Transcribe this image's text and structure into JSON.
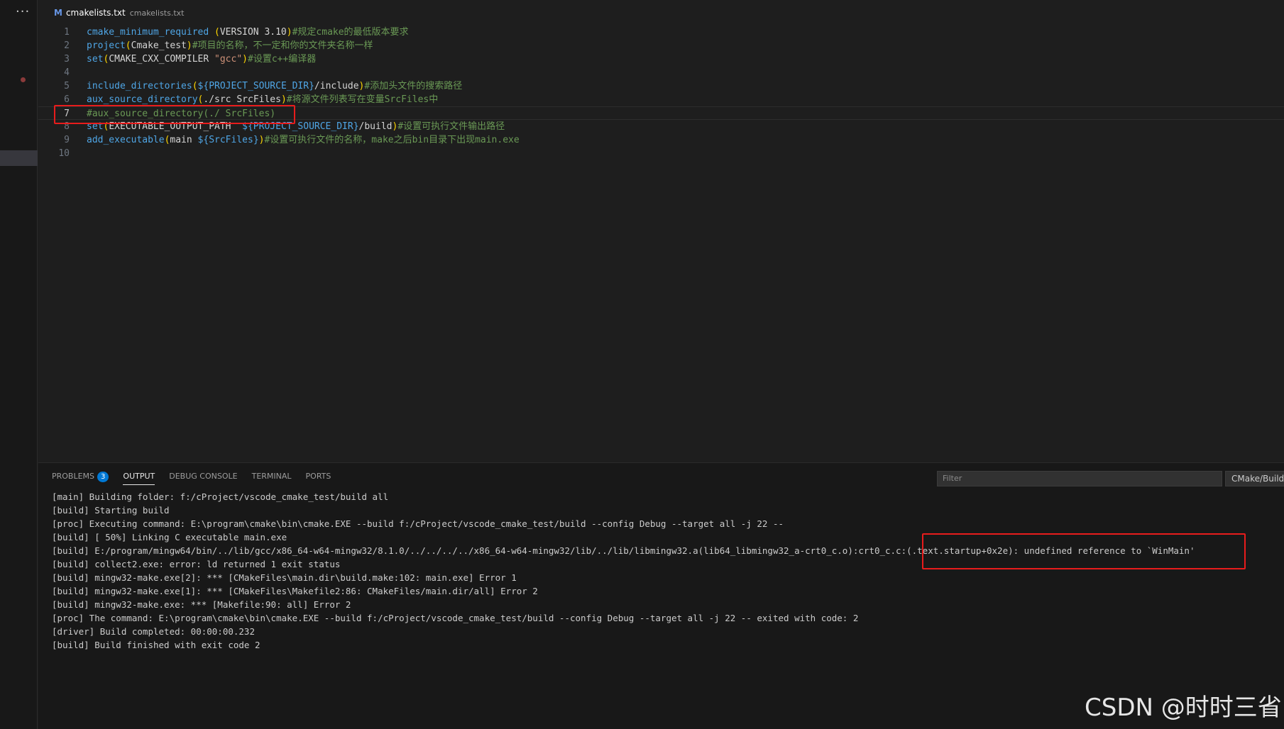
{
  "activity": {
    "more_label": "···"
  },
  "tab": {
    "modified_marker": "M",
    "filename": "cmakelists.txt",
    "path": "cmakelists.txt"
  },
  "editor": {
    "lines": [
      {
        "n": "1",
        "tokens": [
          {
            "c": "k",
            "t": "cmake_minimum_required"
          },
          {
            "c": "t",
            "t": " "
          },
          {
            "c": "p",
            "t": "("
          },
          {
            "c": "t",
            "t": "VERSION 3.10"
          },
          {
            "c": "p",
            "t": ")"
          },
          {
            "c": "c",
            "t": "#规定cmake的最低版本要求"
          }
        ]
      },
      {
        "n": "2",
        "tokens": [
          {
            "c": "k",
            "t": "project"
          },
          {
            "c": "p",
            "t": "("
          },
          {
            "c": "t",
            "t": "Cmake_test"
          },
          {
            "c": "p",
            "t": ")"
          },
          {
            "c": "c",
            "t": "#项目的名称，不一定和你的文件夹名称一样"
          }
        ]
      },
      {
        "n": "3",
        "tokens": [
          {
            "c": "k",
            "t": "set"
          },
          {
            "c": "p",
            "t": "("
          },
          {
            "c": "t",
            "t": "CMAKE_CXX_COMPILER "
          },
          {
            "c": "s",
            "t": "\"gcc\""
          },
          {
            "c": "p",
            "t": ")"
          },
          {
            "c": "c",
            "t": "#设置c++编译器"
          }
        ]
      },
      {
        "n": "4",
        "tokens": []
      },
      {
        "n": "5",
        "tokens": [
          {
            "c": "k",
            "t": "include_directories"
          },
          {
            "c": "p",
            "t": "("
          },
          {
            "c": "v",
            "t": "${PROJECT_SOURCE_DIR}"
          },
          {
            "c": "t",
            "t": "/include"
          },
          {
            "c": "p",
            "t": ")"
          },
          {
            "c": "c",
            "t": "#添加头文件的搜索路径"
          }
        ]
      },
      {
        "n": "6",
        "tokens": [
          {
            "c": "k",
            "t": "aux_source_directory"
          },
          {
            "c": "p",
            "t": "("
          },
          {
            "c": "t",
            "t": "./src SrcFiles"
          },
          {
            "c": "p",
            "t": ")"
          },
          {
            "c": "c",
            "t": "#将源文件列表写在变量SrcFiles中"
          }
        ]
      },
      {
        "n": "7",
        "tokens": [
          {
            "c": "c",
            "t": "#aux_source_directory(./ SrcFiles)"
          }
        ]
      },
      {
        "n": "8",
        "tokens": [
          {
            "c": "k",
            "t": "set"
          },
          {
            "c": "p",
            "t": "("
          },
          {
            "c": "t",
            "t": "EXECUTABLE_OUTPUT_PATH  "
          },
          {
            "c": "v",
            "t": "${PROJECT_SOURCE_DIR}"
          },
          {
            "c": "t",
            "t": "/build"
          },
          {
            "c": "p",
            "t": ")"
          },
          {
            "c": "c",
            "t": "#设置可执行文件输出路径"
          }
        ]
      },
      {
        "n": "9",
        "tokens": [
          {
            "c": "k",
            "t": "add_executable"
          },
          {
            "c": "p",
            "t": "("
          },
          {
            "c": "t",
            "t": "main "
          },
          {
            "c": "v",
            "t": "${SrcFiles}"
          },
          {
            "c": "p",
            "t": ")"
          },
          {
            "c": "c",
            "t": "#设置可执行文件的名称，make之后bin目录下出现main.exe"
          }
        ]
      },
      {
        "n": "10",
        "tokens": []
      }
    ]
  },
  "panel": {
    "tabs": [
      {
        "label": "PROBLEMS",
        "badge": "3"
      },
      {
        "label": "OUTPUT"
      },
      {
        "label": "DEBUG CONSOLE"
      },
      {
        "label": "TERMINAL"
      },
      {
        "label": "PORTS"
      }
    ],
    "filter_placeholder": "Filter",
    "channel": "CMake/Build",
    "output_lines": [
      "[main] Building folder: f:/cProject/vscode_cmake_test/build all",
      "[build] Starting build",
      "[proc] Executing command: E:\\program\\cmake\\bin\\cmake.EXE --build f:/cProject/vscode_cmake_test/build --config Debug --target all -j 22 --",
      "[build] [ 50%] Linking C executable main.exe",
      "[build] E:/program/mingw64/bin/../lib/gcc/x86_64-w64-mingw32/8.1.0/../../../../x86_64-w64-mingw32/lib/../lib/libmingw32.a(lib64_libmingw32_a-crt0_c.o):crt0_c.c:(.text.startup+0x2e): undefined reference to `WinMain'",
      "[build] collect2.exe: error: ld returned 1 exit status",
      "[build] mingw32-make.exe[2]: *** [CMakeFiles\\main.dir\\build.make:102: main.exe] Error 1",
      "[build] mingw32-make.exe[1]: *** [CMakeFiles\\Makefile2:86: CMakeFiles/main.dir/all] Error 2",
      "[build] mingw32-make.exe: *** [Makefile:90: all] Error 2",
      "[proc] The command: E:\\program\\cmake\\bin\\cmake.EXE --build f:/cProject/vscode_cmake_test/build --config Debug --target all -j 22 -- exited with code: 2",
      "[driver] Build completed: 00:00:00.232",
      "[build] Build finished with exit code 2"
    ]
  },
  "watermark": "CSDN @时时三省"
}
